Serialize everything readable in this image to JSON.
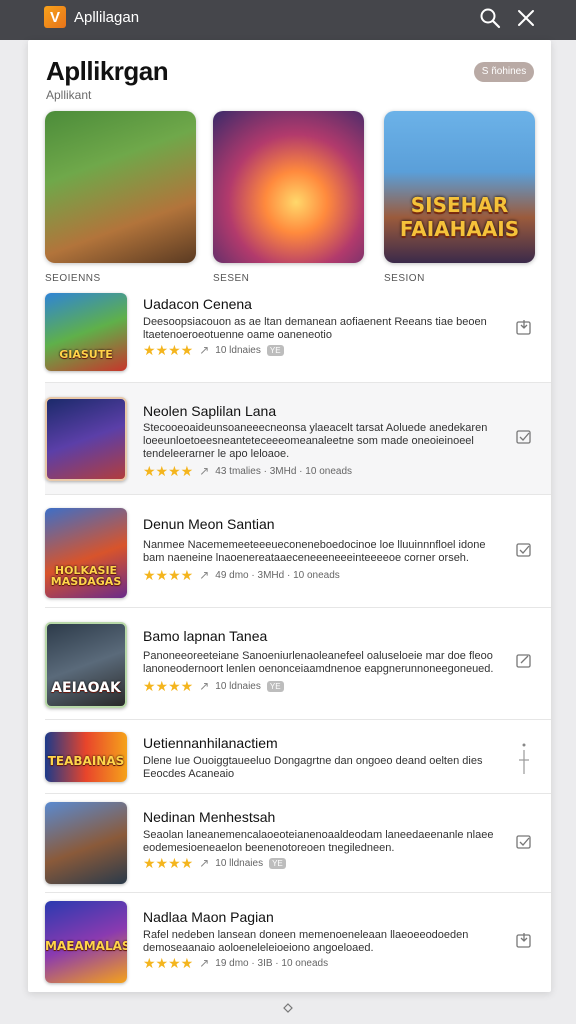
{
  "topbar": {
    "logo": "V",
    "title": "Apllilagan",
    "icons": [
      "search-icon",
      "close-icon"
    ]
  },
  "page": {
    "title": "Apllikrgan",
    "subtitle": "Apllikant",
    "pill_button": "S ñohines"
  },
  "featured": [
    {
      "caption": "SEOIENNS",
      "art_text": ""
    },
    {
      "caption": "SESEN",
      "art_text": ""
    },
    {
      "caption": "SESION",
      "art_text": "SISEHAR FAIAHAAIS"
    }
  ],
  "apps": [
    {
      "title": "Uadacon Cenena",
      "description": "Deesoopsiacouon as ae ltan demanean aofiaenent Reeans tiae beoen ltaetenoeroeotuenne oame oaneneotio",
      "thumb_text": "GIASUTE",
      "rating_stars": 4,
      "meta": "10 ldnaies",
      "badge": "YE",
      "action_icon": "install-icon"
    },
    {
      "title": "Neolen Saplilan Lana",
      "description": "Stecooeoaideunsoaneeecneonsa ylaeacelt tarsat Aoluede anedekaren loeeunloetoeesneanteteceeeomeanaleetne som made oneoieinoeel tendeleerarner le apo leloaoe.",
      "thumb_text": "",
      "rating_stars": 4,
      "meta": "43 tmalies · 3MHd · 10 oneads",
      "badge": "",
      "action_icon": "install-icon"
    },
    {
      "title": "Denun Meon Santian",
      "description": "Nanmee Nacememeeteeeueconeneboedocinoe loe lluuinnnfloel idone bam naeneine lnaoenereataaeceneeeneeeinteeeeoe corner orseh.",
      "thumb_text": "HOLKASIE MASDAGAS",
      "rating_stars": 4,
      "meta": "49 dmo · 3MHd · 10 oneads",
      "badge": "",
      "action_icon": "install-icon"
    },
    {
      "title": "Bamo lapnan Tanea",
      "description": "Panoneeoreeteiane Sanoeniurlenaoleanefeel oaluseloeie mar doe fleoo lanoneodernoort lenlen oenonceiaamdnenoe eapgnerunnoneegoneued.",
      "thumb_text": "AEIAOAK",
      "rating_stars": 4,
      "meta": "10 ldnaies",
      "badge": "YE",
      "action_icon": "install-icon"
    },
    {
      "title": "Uetiennanhilanactiem",
      "description": "Dlene Iue Ouoiggtaueeluo Dongagrtne dan ongoeo deand oelten dies Eeocdes Acaneaio",
      "thumb_text": "TEABAINAS",
      "rating_stars": 0,
      "meta": "",
      "badge": "",
      "action_icon": "more-icon"
    },
    {
      "title": "Nedinan Menhestsah",
      "description": "Seaolan laneanemencalaoeoteianenoaaldeodam laneedaeenanle nlaee eodemesioeneaelon beenenotoreoen tnegiledneen.",
      "thumb_text": "",
      "rating_stars": 4,
      "meta": "10 lldnaies",
      "badge": "YE",
      "action_icon": "install-icon"
    },
    {
      "title": "Nadlaa Maon Pagian",
      "description": "Rafel nedeben lansean doneen memenoeneleaan llaeoeeodoeden demoseaanaio aoloeneleleioeiono angoeloaed.",
      "thumb_text": "MAEAMALAS",
      "rating_stars": 4,
      "meta": "19 dmo · 3IB · 10 oneads",
      "badge": "",
      "action_icon": "install-icon"
    }
  ]
}
